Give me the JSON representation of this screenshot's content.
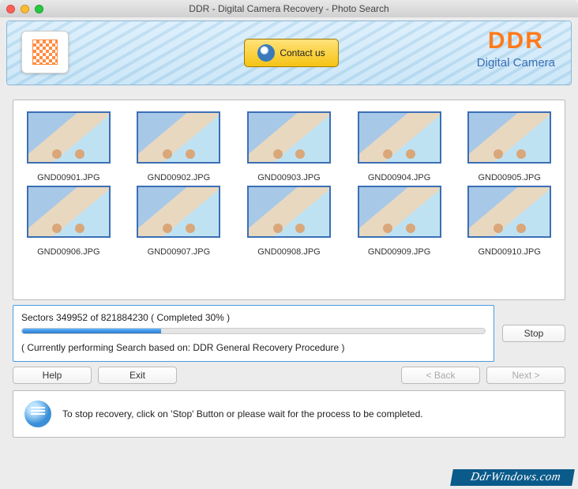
{
  "titlebar": {
    "title": "DDR - Digital Camera Recovery - Photo Search"
  },
  "header": {
    "contact_label": "Contact us",
    "brand_title": "DDR",
    "brand_subtitle": "Digital Camera"
  },
  "gallery": {
    "files": [
      "GND00901.JPG",
      "GND00902.JPG",
      "GND00903.JPG",
      "GND00904.JPG",
      "GND00905.JPG",
      "GND00906.JPG",
      "GND00907.JPG",
      "GND00908.JPG",
      "GND00909.JPG",
      "GND00910.JPG"
    ]
  },
  "progress": {
    "sectors_text": "Sectors 349952 of    821884230   ( Completed 30% )",
    "percent": 30,
    "method_text": "( Currently performing Search based on: DDR General Recovery Procedure )"
  },
  "buttons": {
    "stop": "Stop",
    "help": "Help",
    "exit": "Exit",
    "back": "< Back",
    "next": "Next >"
  },
  "hint": {
    "text": "To stop recovery, click on 'Stop' Button or please wait for the process to be completed."
  },
  "watermark": "DdrWindows.com"
}
